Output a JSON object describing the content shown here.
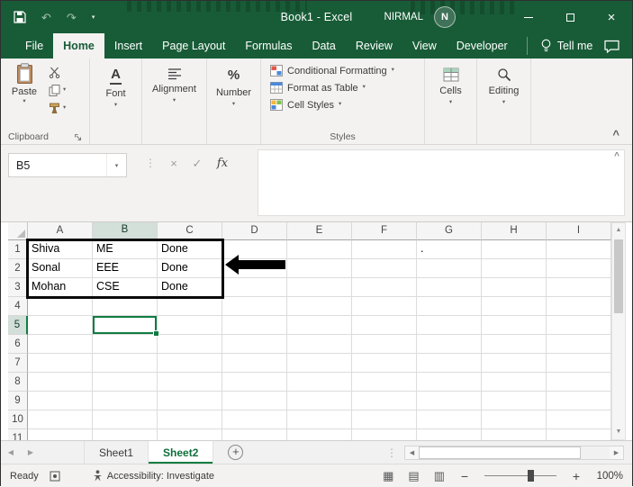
{
  "titlebar": {
    "title": "Book1 - Excel",
    "user": "NIRMAL",
    "user_initial": "N"
  },
  "ribbon_tabs": [
    "File",
    "Home",
    "Insert",
    "Page Layout",
    "Formulas",
    "Data",
    "Review",
    "View",
    "Developer"
  ],
  "active_tab": "Home",
  "tell_me_label": "Tell me",
  "ribbon": {
    "paste_label": "Paste",
    "clipboard_label": "Clipboard",
    "font_label": "Font",
    "alignment_label": "Alignment",
    "number_label": "Number",
    "conditional_formatting_label": "Conditional Formatting",
    "format_as_table_label": "Format as Table",
    "cell_styles_label": "Cell Styles",
    "styles_label": "Styles",
    "cells_label": "Cells",
    "editing_label": "Editing"
  },
  "formula_bar": {
    "name_box_value": "B5",
    "fx_label": "fx"
  },
  "grid": {
    "column_headers": [
      "A",
      "B",
      "C",
      "D",
      "E",
      "F",
      "G",
      "H",
      "I"
    ],
    "row_headers": [
      "1",
      "2",
      "3",
      "4",
      "5",
      "6",
      "7",
      "8",
      "9",
      "10",
      "11"
    ],
    "cells": {
      "A1": "Shiva",
      "B1": "ME",
      "C1": "Done",
      "A2": "Sonal",
      "B2": "EEE",
      "C2": "Done",
      "A3": "Mohan",
      "B3": "CSE",
      "C3": "Done",
      "G1": "."
    },
    "selected_cell": "B5",
    "selected_column": "B",
    "selected_row": "5",
    "highlighted_range": "A1:C3"
  },
  "sheet_tabs": [
    {
      "label": "Sheet1",
      "active": false
    },
    {
      "label": "Sheet2",
      "active": true
    }
  ],
  "status_bar": {
    "mode": "Ready",
    "accessibility": "Accessibility: Investigate",
    "zoom_level": "100%"
  },
  "colors": {
    "accent_green": "#185c37",
    "selection_green": "#107c41"
  },
  "icons": {
    "undo": "↶",
    "redo": "↷",
    "dropdown": "▾",
    "cancel": "×",
    "enter": "✓",
    "dots_vertical": "⋮",
    "expand": "^",
    "collapse": "^",
    "up": "▲",
    "down": "▼",
    "left": "◀",
    "right": "▶",
    "plus": "+",
    "minus": "−",
    "add": "+",
    "view_normal": "▦",
    "view_page_layout": "▤",
    "view_page_break": "▥",
    "close": "×"
  }
}
